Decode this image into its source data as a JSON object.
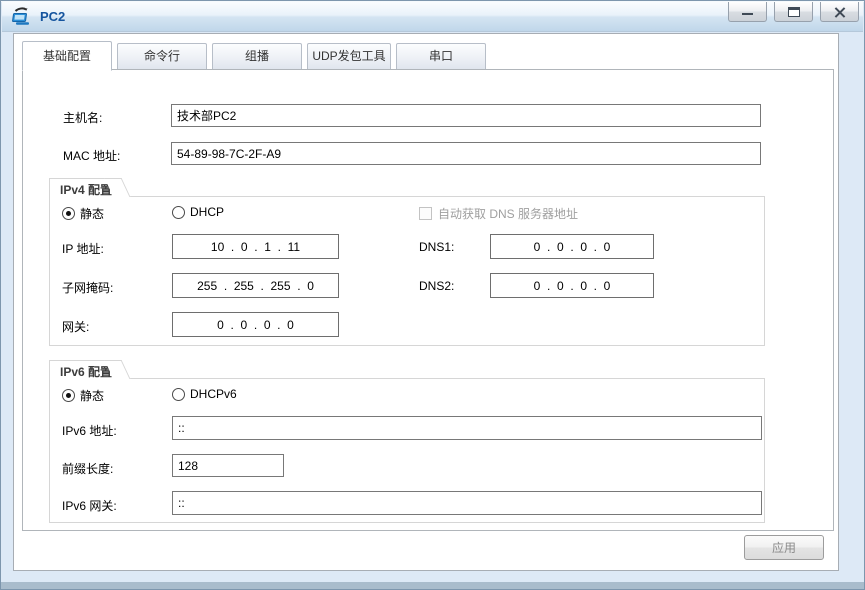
{
  "window": {
    "title": "PC2",
    "icon": "pc-icon",
    "controls": [
      {
        "name": "minimize-button",
        "icon": "minimize-icon"
      },
      {
        "name": "maximize-button",
        "icon": "maximize-icon"
      },
      {
        "name": "close-button",
        "icon": "close-icon"
      }
    ]
  },
  "tabs": [
    {
      "label": "基础配置",
      "active": true
    },
    {
      "label": "命令行",
      "active": false
    },
    {
      "label": "组播",
      "active": false
    },
    {
      "label": "UDP发包工具",
      "active": false
    },
    {
      "label": "串口",
      "active": false
    }
  ],
  "basic": {
    "hostname_label": "主机名:",
    "hostname_value": "技术部PC2",
    "mac_label": "MAC 地址:",
    "mac_value": "54-89-98-7C-2F-A9"
  },
  "ipv4": {
    "group_title": "IPv4 配置",
    "static_label": "静态",
    "static_selected": true,
    "dhcp_label": "DHCP",
    "dhcp_selected": false,
    "dns_auto_label": "自动获取 DNS 服务器地址",
    "dns_auto_checked": false,
    "ip_label": "IP 地址:",
    "ip_value": "10  .  0  .  1  .  11",
    "mask_label": "子网掩码:",
    "mask_value": "255  .  255  .  255  .  0",
    "gateway_label": "网关:",
    "gateway_value": "0  .  0  .  0  .  0",
    "dns1_label": "DNS1:",
    "dns1_value": "0  .  0  .  0  .  0",
    "dns2_label": "DNS2:",
    "dns2_value": "0  .  0  .  0  .  0"
  },
  "ipv6": {
    "group_title": "IPv6 配置",
    "static_label": "静态",
    "static_selected": true,
    "dhcpv6_label": "DHCPv6",
    "dhcpv6_selected": false,
    "address_label": "IPv6 地址:",
    "address_value": "::",
    "prefix_label": "前缀长度:",
    "prefix_value": "128",
    "gateway_label": "IPv6 网关:",
    "gateway_value": "::"
  },
  "footer": {
    "apply_label": "应用"
  },
  "colors": {
    "title_text": "#15549e",
    "frame": "#dde9f6",
    "disabled_text": "#9f9f9f",
    "input_border": "#6e6e6e"
  }
}
